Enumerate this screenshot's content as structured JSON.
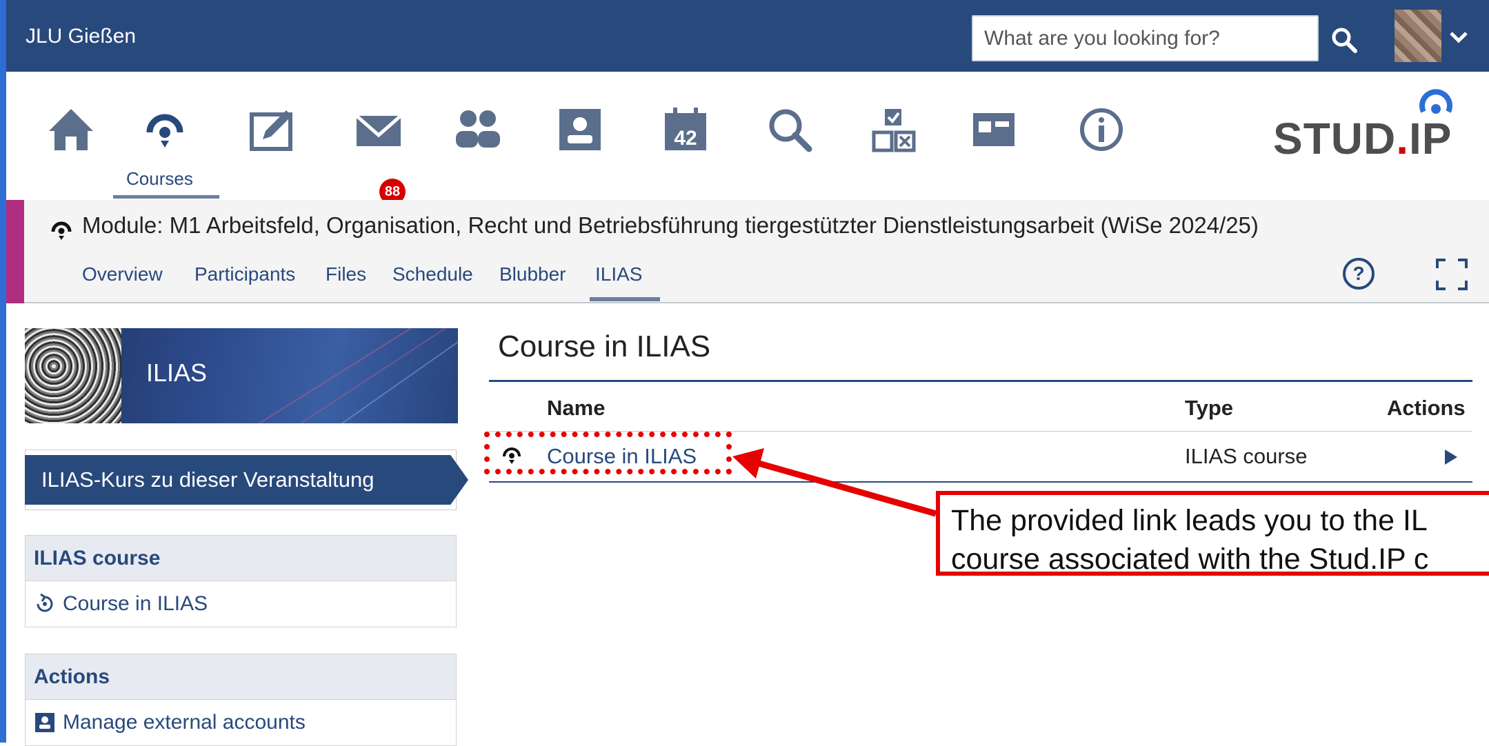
{
  "topbar": {
    "brand": "JLU Gießen",
    "search_placeholder": "What are you looking for?"
  },
  "nav": {
    "items": [
      {
        "name": "home",
        "icon": "home-icon"
      },
      {
        "name": "courses",
        "icon": "courses-icon",
        "label": "Courses",
        "active": true
      },
      {
        "name": "feedback",
        "icon": "edit-icon"
      },
      {
        "name": "messages",
        "icon": "mail-icon",
        "badge": "88"
      },
      {
        "name": "community",
        "icon": "community-icon"
      },
      {
        "name": "profile",
        "icon": "person-icon"
      },
      {
        "name": "calendar",
        "icon": "calendar-icon",
        "day": "42"
      },
      {
        "name": "search",
        "icon": "search-icon"
      },
      {
        "name": "tools",
        "icon": "tools-icon"
      },
      {
        "name": "browse",
        "icon": "browse-icon"
      },
      {
        "name": "info",
        "icon": "info-icon"
      }
    ],
    "logo_text": "STUD.IP",
    "logo_parts": {
      "a": "STUD",
      "dot": ".",
      "b": "IP"
    }
  },
  "course": {
    "title": "Module: M1 Arbeitsfeld, Organisation, Recht und Betriebsführung tiergestützter Dienstleistungsarbeit (WiSe 2024/25)",
    "tabs": [
      "Overview",
      "Participants",
      "Files",
      "Schedule",
      "Blubber",
      "ILIAS"
    ],
    "active_tab": "ILIAS"
  },
  "sidebar": {
    "banner_label": "ILIAS",
    "nav_item": "ILIAS-Kurs zu dieser Veranstaltung",
    "widgets": [
      {
        "title": "ILIAS course",
        "items": [
          {
            "label": "Course in ILIAS",
            "icon": "external-course-icon"
          }
        ]
      },
      {
        "title": "Actions",
        "items": [
          {
            "label": "Manage external accounts",
            "icon": "person-icon"
          }
        ]
      }
    ]
  },
  "main": {
    "title": "Course in ILIAS",
    "table": {
      "columns": [
        "Name",
        "Type",
        "Actions"
      ],
      "rows": [
        {
          "name": "Course in ILIAS",
          "type": "ILIAS course",
          "action_icon": "play-icon"
        }
      ]
    }
  },
  "annotation": {
    "callout_line1": "The provided link leads you to the IL",
    "callout_line2": "course associated with the Stud.IP c",
    "color": "#e60000"
  },
  "colors": {
    "primary": "#28497c",
    "accent": "#b02e7f",
    "badge": "#d60000",
    "logo_red": "#d60000"
  }
}
